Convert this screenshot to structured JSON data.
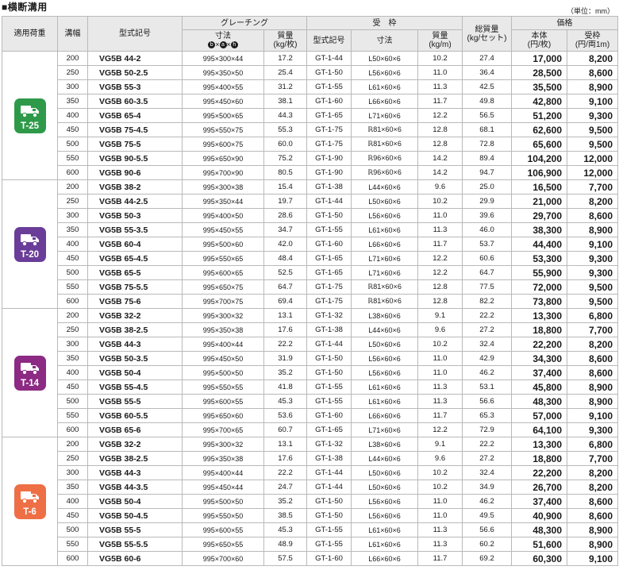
{
  "title": "■横断溝用",
  "unit_note": "（単位：mm）",
  "headers": {
    "load": "適用荷重",
    "width": "溝幅",
    "model": "型式記号",
    "grating": "グレーチング",
    "grating_dim": "寸法",
    "grating_dim_b": "b",
    "grating_dim_a": "a",
    "grating_dim_h": "h",
    "times": "×",
    "grating_mass": "質量\n(kg/枚)",
    "frame": "受　枠",
    "frame_model": "型式記号",
    "frame_dim": "寸法",
    "frame_mass": "質量\n(kg/m)",
    "total_mass": "総質量\n(kg/セット)",
    "price": "価格",
    "price_main": "本体\n(円/枚)",
    "price_frame": "受枠\n(円/両1m)"
  },
  "colors": {
    "T-25": "#2e9a49",
    "T-20": "#6a3d98",
    "T-14": "#8c2a84",
    "T-6": "#ee6f45"
  },
  "groups": [
    {
      "load": "T-25",
      "rows": [
        [
          "200",
          "VG5B 44-2",
          "995×300×44",
          "17.2",
          "GT-1-44",
          "L50×60×6",
          "10.2",
          "27.4",
          "17,000",
          "8,200"
        ],
        [
          "250",
          "VG5B 50-2.5",
          "995×350×50",
          "25.4",
          "GT-1-50",
          "L56×60×6",
          "11.0",
          "36.4",
          "28,500",
          "8,600"
        ],
        [
          "300",
          "VG5B 55-3",
          "995×400×55",
          "31.2",
          "GT-1-55",
          "L61×60×6",
          "11.3",
          "42.5",
          "35,500",
          "8,900"
        ],
        [
          "350",
          "VG5B 60-3.5",
          "995×450×60",
          "38.1",
          "GT-1-60",
          "L66×60×6",
          "11.7",
          "49.8",
          "42,800",
          "9,100"
        ],
        [
          "400",
          "VG5B 65-4",
          "995×500×65",
          "44.3",
          "GT-1-65",
          "L71×60×6",
          "12.2",
          "56.5",
          "51,200",
          "9,300"
        ],
        [
          "450",
          "VG5B 75-4.5",
          "995×550×75",
          "55.3",
          "GT-1-75",
          "ℝ81×60×6",
          "12.8",
          "68.1",
          "62,600",
          "9,500"
        ],
        [
          "500",
          "VG5B 75-5",
          "995×600×75",
          "60.0",
          "GT-1-75",
          "ℝ81×60×6",
          "12.8",
          "72.8",
          "65,600",
          "9,500"
        ],
        [
          "550",
          "VG5B 90-5.5",
          "995×650×90",
          "75.2",
          "GT-1-90",
          "ℝ96×60×6",
          "14.2",
          "89.4",
          "104,200",
          "12,000"
        ],
        [
          "600",
          "VG5B 90-6",
          "995×700×90",
          "80.5",
          "GT-1-90",
          "ℝ96×60×6",
          "14.2",
          "94.7",
          "106,900",
          "12,000"
        ]
      ]
    },
    {
      "load": "T-20",
      "rows": [
        [
          "200",
          "VG5B 38-2",
          "995×300×38",
          "15.4",
          "GT-1-38",
          "L44×60×6",
          "9.6",
          "25.0",
          "16,500",
          "7,700"
        ],
        [
          "250",
          "VG5B 44-2.5",
          "995×350×44",
          "19.7",
          "GT-1-44",
          "L50×60×6",
          "10.2",
          "29.9",
          "21,000",
          "8,200"
        ],
        [
          "300",
          "VG5B 50-3",
          "995×400×50",
          "28.6",
          "GT-1-50",
          "L56×60×6",
          "11.0",
          "39.6",
          "29,700",
          "8,600"
        ],
        [
          "350",
          "VG5B 55-3.5",
          "995×450×55",
          "34.7",
          "GT-1-55",
          "L61×60×6",
          "11.3",
          "46.0",
          "38,300",
          "8,900"
        ],
        [
          "400",
          "VG5B 60-4",
          "995×500×60",
          "42.0",
          "GT-1-60",
          "L66×60×6",
          "11.7",
          "53.7",
          "44,400",
          "9,100"
        ],
        [
          "450",
          "VG5B 65-4.5",
          "995×550×65",
          "48.4",
          "GT-1-65",
          "L71×60×6",
          "12.2",
          "60.6",
          "53,300",
          "9,300"
        ],
        [
          "500",
          "VG5B 65-5",
          "995×600×65",
          "52.5",
          "GT-1-65",
          "L71×60×6",
          "12.2",
          "64.7",
          "55,900",
          "9,300"
        ],
        [
          "550",
          "VG5B 75-5.5",
          "995×650×75",
          "64.7",
          "GT-1-75",
          "ℝ81×60×6",
          "12.8",
          "77.5",
          "72,000",
          "9,500"
        ],
        [
          "600",
          "VG5B 75-6",
          "995×700×75",
          "69.4",
          "GT-1-75",
          "ℝ81×60×6",
          "12.8",
          "82.2",
          "73,800",
          "9,500"
        ]
      ]
    },
    {
      "load": "T-14",
      "rows": [
        [
          "200",
          "VG5B 32-2",
          "995×300×32",
          "13.1",
          "GT-1-32",
          "L38×60×6",
          "9.1",
          "22.2",
          "13,300",
          "6,800"
        ],
        [
          "250",
          "VG5B 38-2.5",
          "995×350×38",
          "17.6",
          "GT-1-38",
          "L44×60×6",
          "9.6",
          "27.2",
          "18,800",
          "7,700"
        ],
        [
          "300",
          "VG5B 44-3",
          "995×400×44",
          "22.2",
          "GT-1-44",
          "L50×60×6",
          "10.2",
          "32.4",
          "22,200",
          "8,200"
        ],
        [
          "350",
          "VG5B 50-3.5",
          "995×450×50",
          "31.9",
          "GT-1-50",
          "L56×60×6",
          "11.0",
          "42.9",
          "34,300",
          "8,600"
        ],
        [
          "400",
          "VG5B 50-4",
          "995×500×50",
          "35.2",
          "GT-1-50",
          "L56×60×6",
          "11.0",
          "46.2",
          "37,400",
          "8,600"
        ],
        [
          "450",
          "VG5B 55-4.5",
          "995×550×55",
          "41.8",
          "GT-1-55",
          "L61×60×6",
          "11.3",
          "53.1",
          "45,800",
          "8,900"
        ],
        [
          "500",
          "VG5B 55-5",
          "995×600×55",
          "45.3",
          "GT-1-55",
          "L61×60×6",
          "11.3",
          "56.6",
          "48,300",
          "8,900"
        ],
        [
          "550",
          "VG5B 60-5.5",
          "995×650×60",
          "53.6",
          "GT-1-60",
          "L66×60×6",
          "11.7",
          "65.3",
          "57,000",
          "9,100"
        ],
        [
          "600",
          "VG5B 65-6",
          "995×700×65",
          "60.7",
          "GT-1-65",
          "L71×60×6",
          "12.2",
          "72.9",
          "64,100",
          "9,300"
        ]
      ]
    },
    {
      "load": "T-6",
      "rows": [
        [
          "200",
          "VG5B 32-2",
          "995×300×32",
          "13.1",
          "GT-1-32",
          "L38×60×6",
          "9.1",
          "22.2",
          "13,300",
          "6,800"
        ],
        [
          "250",
          "VG5B 38-2.5",
          "995×350×38",
          "17.6",
          "GT-1-38",
          "L44×60×6",
          "9.6",
          "27.2",
          "18,800",
          "7,700"
        ],
        [
          "300",
          "VG5B 44-3",
          "995×400×44",
          "22.2",
          "GT-1-44",
          "L50×60×6",
          "10.2",
          "32.4",
          "22,200",
          "8,200"
        ],
        [
          "350",
          "VG5B 44-3.5",
          "995×450×44",
          "24.7",
          "GT-1-44",
          "L50×60×6",
          "10.2",
          "34.9",
          "26,700",
          "8,200"
        ],
        [
          "400",
          "VG5B 50-4",
          "995×500×50",
          "35.2",
          "GT-1-50",
          "L56×60×6",
          "11.0",
          "46.2",
          "37,400",
          "8,600"
        ],
        [
          "450",
          "VG5B 50-4.5",
          "995×550×50",
          "38.5",
          "GT-1-50",
          "L56×60×6",
          "11.0",
          "49.5",
          "40,900",
          "8,600"
        ],
        [
          "500",
          "VG5B 55-5",
          "995×600×55",
          "45.3",
          "GT-1-55",
          "L61×60×6",
          "11.3",
          "56.6",
          "48,300",
          "8,900"
        ],
        [
          "550",
          "VG5B 55-5.5",
          "995×650×55",
          "48.9",
          "GT-1-55",
          "L61×60×6",
          "11.3",
          "60.2",
          "51,600",
          "8,900"
        ],
        [
          "600",
          "VG5B 60-6",
          "995×700×60",
          "57.5",
          "GT-1-60",
          "L66×60×6",
          "11.7",
          "69.2",
          "60,300",
          "9,100"
        ]
      ]
    }
  ]
}
